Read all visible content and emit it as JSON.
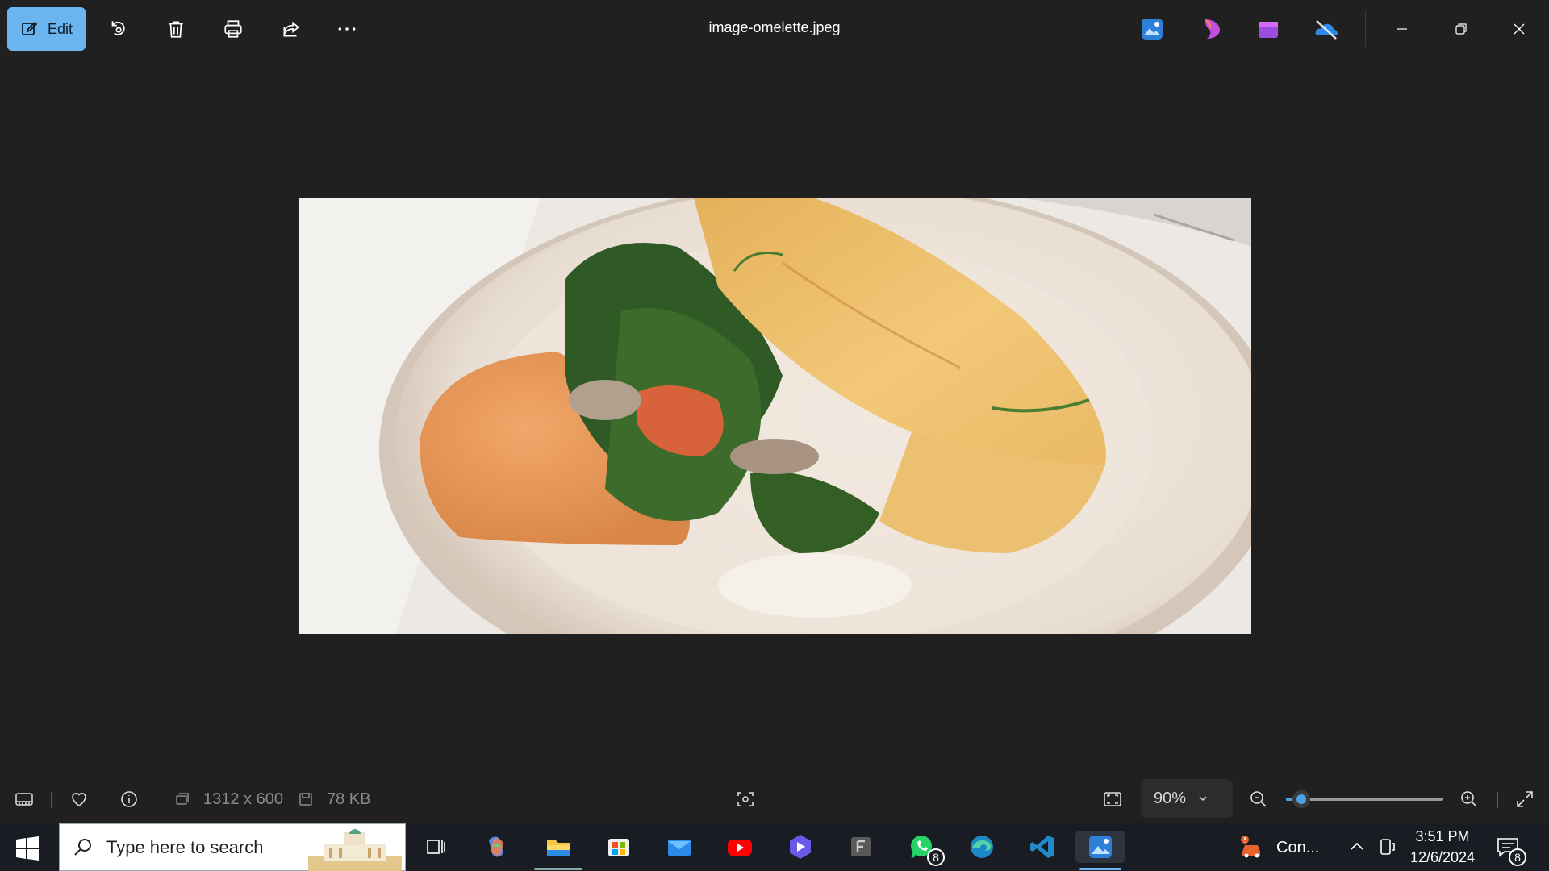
{
  "window": {
    "title": "image-omelette.jpeg"
  },
  "toolbar": {
    "edit_label": "Edit",
    "icons": [
      "edit-icon",
      "rotate-icon",
      "delete-icon",
      "print-icon",
      "share-icon",
      "more-icon"
    ]
  },
  "app_icons": [
    "photos-icon",
    "clipchamp-icon",
    "designer-icon",
    "onedrive-icon"
  ],
  "window_controls": [
    "minimize-icon",
    "restore-icon",
    "close-icon"
  ],
  "status": {
    "dimensions": "1312 x 600",
    "file_size": "78 KB",
    "zoom_value": "90%",
    "zoom_slider_fraction": 0.1
  },
  "taskbar": {
    "search_placeholder": "Type here to search",
    "whatsapp_badge": "8",
    "tray_app_label": "Con...",
    "time": "3:51 PM",
    "date": "12/6/2024",
    "notification_count": "8"
  },
  "colors": {
    "accent": "#6ab4ef",
    "background": "#202020",
    "taskbar": "#1a1c24"
  }
}
